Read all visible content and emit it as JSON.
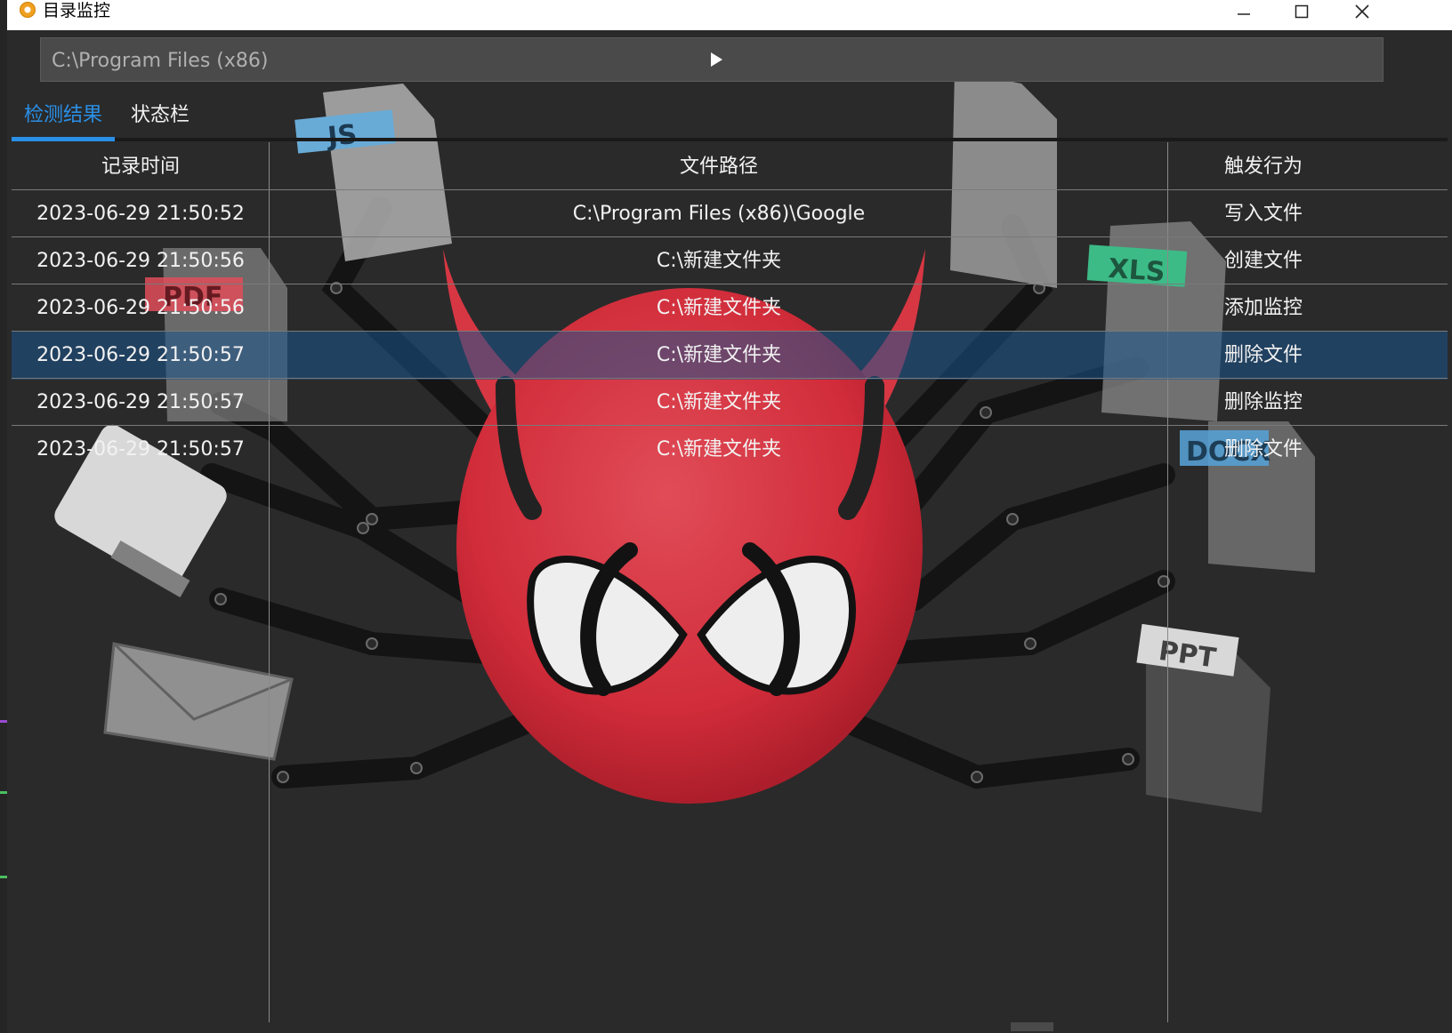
{
  "window": {
    "title": "目录监控",
    "minimize_glyph": "—",
    "maximize_glyph": "☐",
    "close_glyph": "✕"
  },
  "pathbar": {
    "value": "C:\\Program Files (x86)",
    "run_icon": "play-icon"
  },
  "tabs": [
    {
      "label": "检测结果",
      "active": true
    },
    {
      "label": "状态栏",
      "active": false
    }
  ],
  "table": {
    "headers": [
      "记录时间",
      "文件路径",
      "触发行为"
    ],
    "rows": [
      {
        "time": "2023-06-29 21:50:52",
        "path": "C:\\Program Files (x86)\\Google",
        "action": "写入文件"
      },
      {
        "time": "2023-06-29 21:50:56",
        "path": "C:\\新建文件夹",
        "action": "创建文件"
      },
      {
        "time": "2023-06-29 21:50:56",
        "path": "C:\\新建文件夹",
        "action": "添加监控"
      },
      {
        "time": "2023-06-29 21:50:57",
        "path": "C:\\新建文件夹",
        "action": "删除文件",
        "selected": true
      },
      {
        "time": "2023-06-29 21:50:57",
        "path": "C:\\新建文件夹",
        "action": "删除监控"
      },
      {
        "time": "2023-06-29 21:50:57",
        "path": "C:\\新建文件夹",
        "action": "删除文件"
      }
    ]
  },
  "artwork": {
    "labels": [
      "JS",
      "PDF",
      "XLS",
      "DOCX",
      "PPT"
    ],
    "colors": {
      "accent": "#2a8fe6",
      "spider": "#e53946",
      "js": "#6fb7e6",
      "pdf": "#f0505e",
      "xls": "#3ec890",
      "docx": "#5aa8e0",
      "ppt": "#e8e8e8"
    }
  }
}
